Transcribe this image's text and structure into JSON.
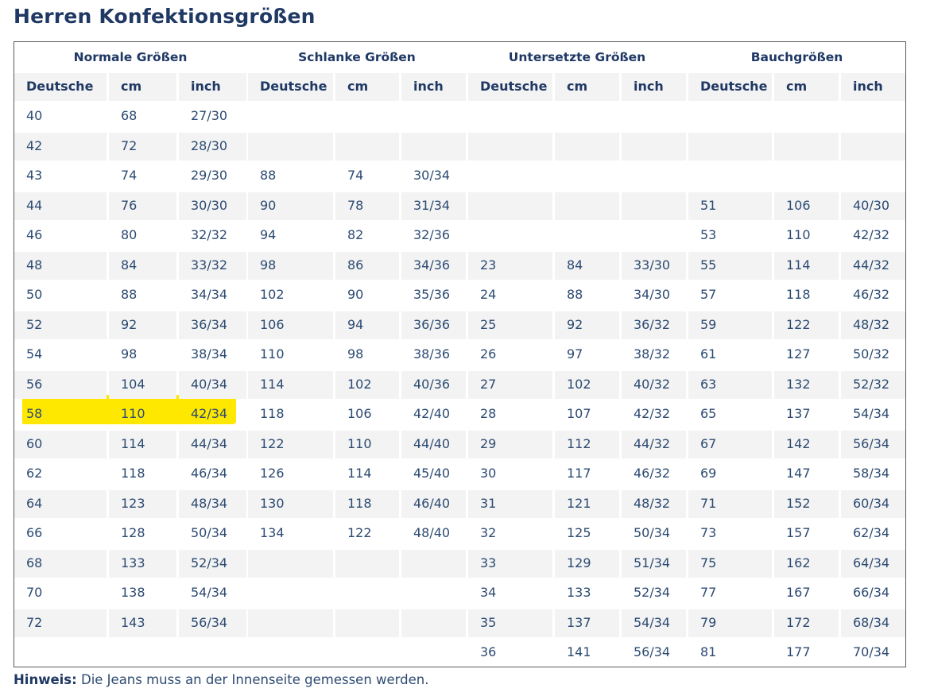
{
  "title": "Herren Konfektionsgrößen",
  "groups": [
    "Normale Größen",
    "Schlanke Größen",
    "Untersetzte Größen",
    "Bauchgrößen"
  ],
  "column_headers": [
    "Deutsche",
    "cm",
    "inch",
    "Deutsche",
    "cm",
    "inch",
    "Deutsche",
    "cm",
    "inch",
    "Deutsche",
    "cm",
    "inch"
  ],
  "rows": [
    [
      "40",
      "68",
      "27/30",
      "",
      "",
      "",
      "",
      "",
      "",
      "",
      "",
      ""
    ],
    [
      "42",
      "72",
      "28/30",
      "",
      "",
      "",
      "",
      "",
      "",
      "",
      "",
      ""
    ],
    [
      "43",
      "74",
      "29/30",
      "88",
      "74",
      "30/34",
      "",
      "",
      "",
      "",
      "",
      ""
    ],
    [
      "44",
      "76",
      "30/30",
      "90",
      "78",
      "31/34",
      "",
      "",
      "",
      "51",
      "106",
      "40/30"
    ],
    [
      "46",
      "80",
      "32/32",
      "94",
      "82",
      "32/36",
      "",
      "",
      "",
      "53",
      "110",
      "42/32"
    ],
    [
      "48",
      "84",
      "33/32",
      "98",
      "86",
      "34/36",
      "23",
      "84",
      "33/30",
      "55",
      "114",
      "44/32"
    ],
    [
      "50",
      "88",
      "34/34",
      "102",
      "90",
      "35/36",
      "24",
      "88",
      "34/30",
      "57",
      "118",
      "46/32"
    ],
    [
      "52",
      "92",
      "36/34",
      "106",
      "94",
      "36/36",
      "25",
      "92",
      "36/32",
      "59",
      "122",
      "48/32"
    ],
    [
      "54",
      "98",
      "38/34",
      "110",
      "98",
      "38/36",
      "26",
      "97",
      "38/32",
      "61",
      "127",
      "50/32"
    ],
    [
      "56",
      "104",
      "40/34",
      "114",
      "102",
      "40/36",
      "27",
      "102",
      "40/32",
      "63",
      "132",
      "52/32"
    ],
    [
      "58",
      "110",
      "42/34",
      "118",
      "106",
      "42/40",
      "28",
      "107",
      "42/32",
      "65",
      "137",
      "54/34"
    ],
    [
      "60",
      "114",
      "44/34",
      "122",
      "110",
      "44/40",
      "29",
      "112",
      "44/32",
      "67",
      "142",
      "56/34"
    ],
    [
      "62",
      "118",
      "46/34",
      "126",
      "114",
      "45/40",
      "30",
      "117",
      "46/32",
      "69",
      "147",
      "58/34"
    ],
    [
      "64",
      "123",
      "48/34",
      "130",
      "118",
      "46/40",
      "31",
      "121",
      "48/32",
      "71",
      "152",
      "60/34"
    ],
    [
      "66",
      "128",
      "50/34",
      "134",
      "122",
      "48/40",
      "32",
      "125",
      "50/34",
      "73",
      "157",
      "62/34"
    ],
    [
      "68",
      "133",
      "52/34",
      "",
      "",
      "",
      "33",
      "129",
      "51/34",
      "75",
      "162",
      "64/34"
    ],
    [
      "70",
      "138",
      "54/34",
      "",
      "",
      "",
      "34",
      "133",
      "52/34",
      "77",
      "167",
      "66/34"
    ],
    [
      "72",
      "143",
      "56/34",
      "",
      "",
      "",
      "35",
      "137",
      "54/34",
      "79",
      "172",
      "68/34"
    ],
    [
      "",
      "",
      "",
      "",
      "",
      "",
      "36",
      "141",
      "56/34",
      "81",
      "177",
      "70/34"
    ]
  ],
  "highlighted_row": 10,
  "highlight_color": "#ffe800",
  "note": {
    "label": "Hinweis:",
    "text": "Die Jeans muss an der Innenseite gemessen werden."
  }
}
